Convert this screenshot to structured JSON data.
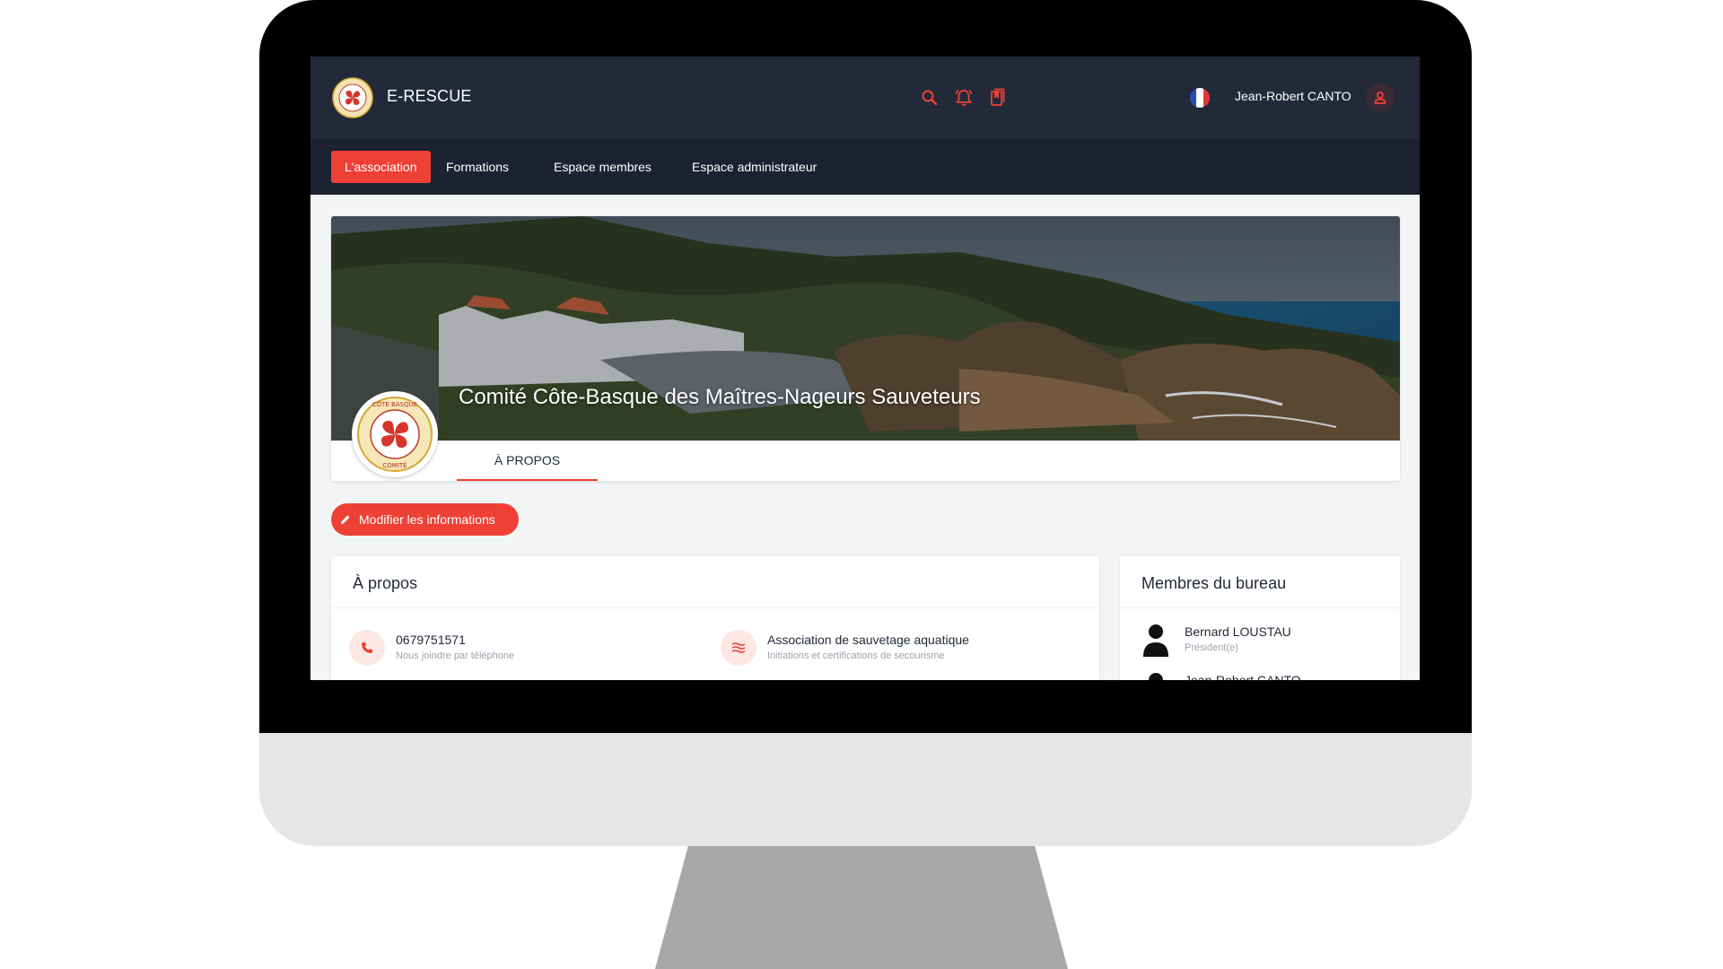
{
  "app": {
    "name": "E-RESCUE"
  },
  "user": {
    "name": "Jean-Robert CANTO"
  },
  "topbar_icons": [
    "search-icon",
    "bell-icon",
    "bookmark-icon",
    "flag-fr-icon",
    "user-icon"
  ],
  "nav": {
    "items": [
      {
        "label": "L'association",
        "active": true
      },
      {
        "label": "Formations",
        "active": false
      },
      {
        "label": "Espace membres",
        "active": false
      },
      {
        "label": "Espace administrateur",
        "active": false
      }
    ]
  },
  "cover": {
    "title": "Comité Côte-Basque des Maîtres-Nageurs Sauveteurs",
    "logo_text": "COMITÉ CÔTE BASQUE MNS",
    "tabs": [
      {
        "label": "À PROPOS",
        "active": true
      }
    ]
  },
  "actions": {
    "edit_label": "Modifier les informations"
  },
  "about": {
    "title": "À propos",
    "items": [
      {
        "icon": "phone-icon",
        "main": "0679751571",
        "sub": "Nous joindre par téléphone"
      },
      {
        "icon": "waves-icon",
        "main": "Association de sauvetage aquatique",
        "sub": "Initiations et certifications de secourisme"
      }
    ]
  },
  "bureau": {
    "title": "Membres du bureau",
    "members": [
      {
        "name": "Bernard LOUSTAU",
        "role": "Président(e)"
      },
      {
        "name": "Jean-Robert CANTO",
        "role": ""
      }
    ]
  },
  "colors": {
    "accent": "#ef4035",
    "header_bg": "#222a3a",
    "nav_bg": "#1c2232",
    "page_bg": "#f3f4f6"
  }
}
